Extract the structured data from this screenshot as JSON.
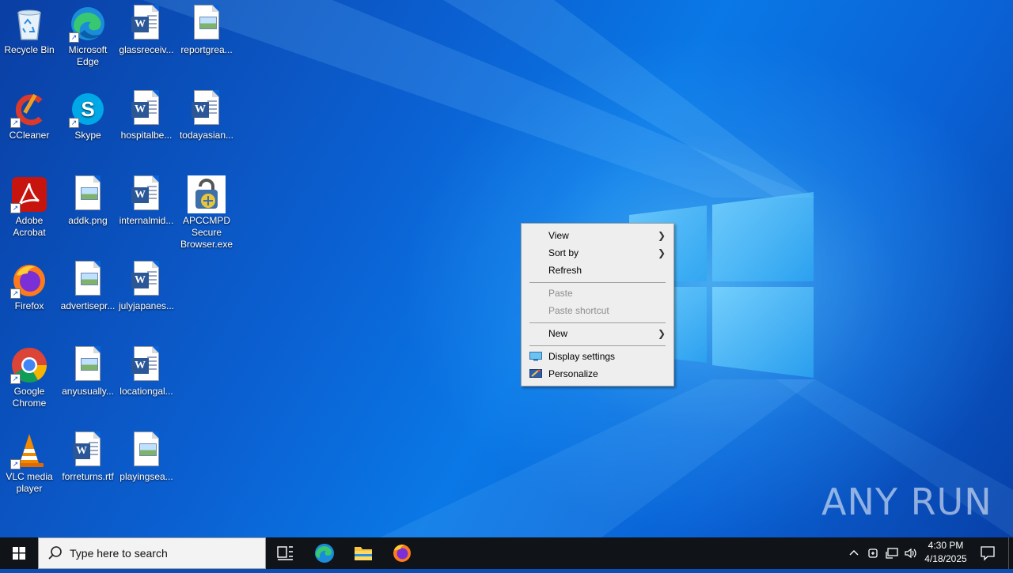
{
  "desktop": {
    "icons": [
      {
        "label": "Recycle Bin"
      },
      {
        "label": "Microsoft Edge"
      },
      {
        "label": "glassreceiv..."
      },
      {
        "label": "reportgrea..."
      },
      {
        "label": "CCleaner"
      },
      {
        "label": "Skype"
      },
      {
        "label": "hospitalbe..."
      },
      {
        "label": "todayasian..."
      },
      {
        "label": "Adobe Acrobat"
      },
      {
        "label": "addk.png"
      },
      {
        "label": "internalmid..."
      },
      {
        "label": "APCCMPD Secure Browser.exe"
      },
      {
        "label": "Firefox"
      },
      {
        "label": "advertisepr..."
      },
      {
        "label": "julyjapanes..."
      },
      {
        "label": "Google Chrome"
      },
      {
        "label": "anyusually..."
      },
      {
        "label": "locationgal..."
      },
      {
        "label": "VLC media player"
      },
      {
        "label": "forreturns.rtf"
      },
      {
        "label": "playingsea..."
      }
    ]
  },
  "context_menu": {
    "items": [
      {
        "label": "View"
      },
      {
        "label": "Sort by"
      },
      {
        "label": "Refresh"
      },
      {
        "label": "Paste"
      },
      {
        "label": "Paste shortcut"
      },
      {
        "label": "New"
      },
      {
        "label": "Display settings"
      },
      {
        "label": "Personalize"
      }
    ]
  },
  "taskbar": {
    "search_placeholder": "Type here to search",
    "time": "4:30 PM",
    "date": "4/18/2025"
  },
  "watermark": "ANY RUN"
}
